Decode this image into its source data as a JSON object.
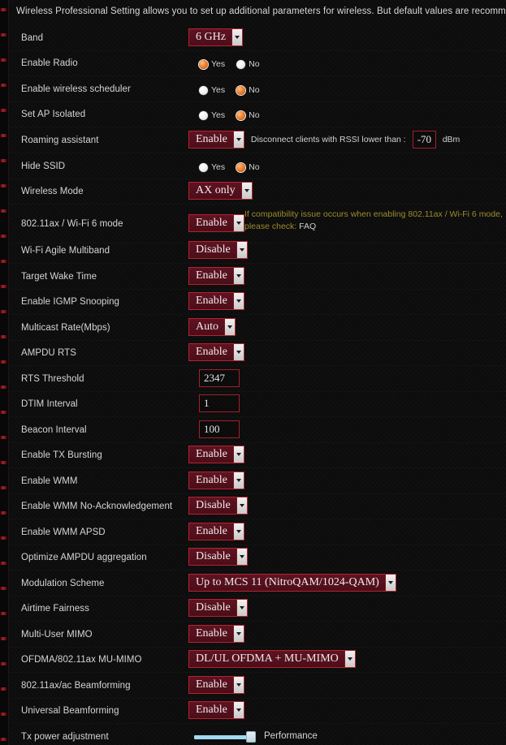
{
  "page": {
    "intro": "Wireless Professional Setting allows you to set up additional parameters for wireless. But default values are recommended."
  },
  "theme": {
    "background": "#0c0c0c",
    "select_bg": "#55101c",
    "select_border": "#b3212e",
    "input_border": "#a21d2a",
    "radio_on": "#ef7f2c",
    "hint_color": "#9a8b2c",
    "slider_track": "#9fd9f2"
  },
  "radio_options": {
    "yes": "Yes",
    "no": "No"
  },
  "hint": {
    "line1": "If compatibility issue occurs when enabling 802.11ax / Wi-Fi 6 mode,",
    "line2_prefix": "please check: ",
    "link": "FAQ"
  },
  "roaming": {
    "condition_text": "Disconnect clients with RSSI lower than :",
    "rssi_value": "-70",
    "unit": "dBm"
  },
  "tx_power": {
    "label": "Performance",
    "value": 86
  },
  "rows": [
    {
      "label": "Band",
      "type": "select",
      "value": "6 GHz"
    },
    {
      "label": "Enable Radio",
      "type": "radio",
      "value": "Yes"
    },
    {
      "label": "Enable wireless scheduler",
      "type": "radio",
      "value": "No"
    },
    {
      "label": "Set AP Isolated",
      "type": "radio",
      "value": "No"
    },
    {
      "label": "Roaming assistant",
      "type": "select-inline",
      "value": "Enable"
    },
    {
      "label": "Hide SSID",
      "type": "radio",
      "value": "No"
    },
    {
      "label": "Wireless Mode",
      "type": "select",
      "value": "AX only"
    },
    {
      "label": "802.11ax / Wi-Fi 6 mode",
      "type": "select",
      "value": "Enable"
    },
    {
      "label": "Wi-Fi Agile Multiband",
      "type": "select",
      "value": "Disable"
    },
    {
      "label": "Target Wake Time",
      "type": "select",
      "value": "Enable"
    },
    {
      "label": "Enable IGMP Snooping",
      "type": "select",
      "value": "Enable"
    },
    {
      "label": "Multicast Rate(Mbps)",
      "type": "select",
      "value": "Auto"
    },
    {
      "label": "AMPDU RTS",
      "type": "select",
      "value": "Enable"
    },
    {
      "label": "RTS Threshold",
      "type": "text",
      "value": "2347"
    },
    {
      "label": "DTIM Interval",
      "type": "text",
      "value": "1"
    },
    {
      "label": "Beacon Interval",
      "type": "text",
      "value": "100"
    },
    {
      "label": "Enable TX Bursting",
      "type": "select",
      "value": "Enable"
    },
    {
      "label": "Enable WMM",
      "type": "select",
      "value": "Enable"
    },
    {
      "label": "Enable WMM No-Acknowledgement",
      "type": "select",
      "value": "Disable"
    },
    {
      "label": "Enable WMM APSD",
      "type": "select",
      "value": "Enable"
    },
    {
      "label": "Optimize AMPDU aggregation",
      "type": "select",
      "value": "Disable"
    },
    {
      "label": "Modulation Scheme",
      "type": "select",
      "value": "Up to MCS 11 (NitroQAM/1024-QAM)"
    },
    {
      "label": "Airtime Fairness",
      "type": "select",
      "value": "Disable"
    },
    {
      "label": "Multi-User MIMO",
      "type": "select",
      "value": "Enable"
    },
    {
      "label": "OFDMA/802.11ax MU-MIMO",
      "type": "select",
      "value": "DL/UL OFDMA + MU-MIMO"
    },
    {
      "label": "802.11ax/ac Beamforming",
      "type": "select",
      "value": "Enable"
    },
    {
      "label": "Universal Beamforming",
      "type": "select",
      "value": "Enable"
    },
    {
      "label": "Tx power adjustment",
      "type": "slider",
      "value": "Performance"
    }
  ]
}
